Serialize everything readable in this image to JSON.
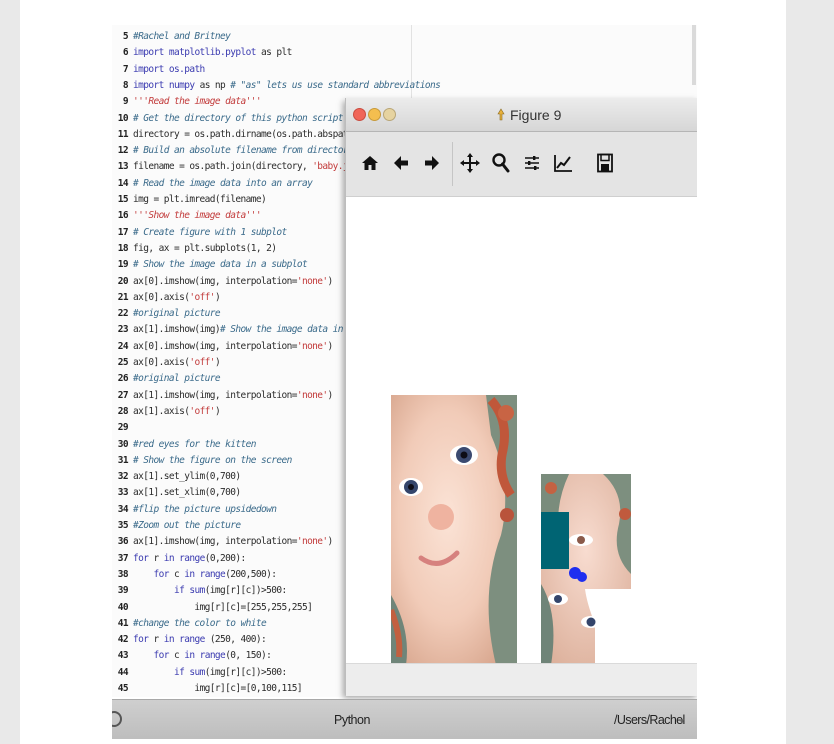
{
  "editor": {
    "lines": [
      {
        "n": "5",
        "parts": [
          {
            "c": "cm",
            "t": "#Rachel and Britney"
          }
        ]
      },
      {
        "n": "6",
        "parts": [
          {
            "c": "kw",
            "t": "import "
          },
          {
            "c": "kw",
            "t": "matplotlib.pyplot"
          },
          {
            "c": "",
            "t": " as plt"
          }
        ]
      },
      {
        "n": "7",
        "parts": [
          {
            "c": "kw",
            "t": "import "
          },
          {
            "c": "kw",
            "t": "os.path"
          }
        ]
      },
      {
        "n": "8",
        "parts": [
          {
            "c": "kw",
            "t": "import "
          },
          {
            "c": "kw",
            "t": "numpy"
          },
          {
            "c": "",
            "t": " as np "
          },
          {
            "c": "cm",
            "t": "# \"as\" lets us use standard abbreviations"
          }
        ]
      },
      {
        "n": "9",
        "parts": [
          {
            "c": "doc",
            "t": "'''Read the image data'''"
          }
        ]
      },
      {
        "n": "10",
        "parts": [
          {
            "c": "cm",
            "t": "# Get the directory of this python script"
          }
        ]
      },
      {
        "n": "11",
        "parts": [
          {
            "c": "",
            "t": "directory = os.path.dirname(os.path.abspath(__file__))"
          }
        ]
      },
      {
        "n": "12",
        "parts": [
          {
            "c": "cm",
            "t": "# Build an absolute filename from directory + filename"
          }
        ]
      },
      {
        "n": "13",
        "parts": [
          {
            "c": "",
            "t": "filename = os.path.join(directory, "
          },
          {
            "c": "str",
            "t": "'baby.jpg'"
          },
          {
            "c": "",
            "t": ")"
          }
        ]
      },
      {
        "n": "14",
        "parts": [
          {
            "c": "cm",
            "t": "# Read the image data into an array"
          }
        ]
      },
      {
        "n": "15",
        "parts": [
          {
            "c": "",
            "t": "img = plt.imread(filename)"
          }
        ]
      },
      {
        "n": "16",
        "parts": [
          {
            "c": "doc",
            "t": "'''Show the image data'''"
          }
        ]
      },
      {
        "n": "17",
        "parts": [
          {
            "c": "cm",
            "t": "# Create figure with 1 subplot"
          }
        ]
      },
      {
        "n": "18",
        "parts": [
          {
            "c": "",
            "t": "fig, ax = plt.subplots(1, 2)"
          }
        ]
      },
      {
        "n": "19",
        "parts": [
          {
            "c": "cm",
            "t": "# Show the image data in a subplot"
          }
        ]
      },
      {
        "n": "20",
        "parts": [
          {
            "c": "",
            "t": "ax[0].imshow(img, interpolation="
          },
          {
            "c": "str",
            "t": "'none'"
          },
          {
            "c": "",
            "t": ")"
          }
        ]
      },
      {
        "n": "21",
        "parts": [
          {
            "c": "",
            "t": "ax[0].axis("
          },
          {
            "c": "str",
            "t": "'off'"
          },
          {
            "c": "",
            "t": ")"
          }
        ]
      },
      {
        "n": "22",
        "parts": [
          {
            "c": "cm",
            "t": "#original picture"
          }
        ]
      },
      {
        "n": "23",
        "parts": [
          {
            "c": "",
            "t": "ax[1].imshow(img)"
          },
          {
            "c": "cm",
            "t": "# Show the image data in a subplot"
          }
        ]
      },
      {
        "n": "24",
        "parts": [
          {
            "c": "",
            "t": "ax[0].imshow(img, interpolation="
          },
          {
            "c": "str",
            "t": "'none'"
          },
          {
            "c": "",
            "t": ")"
          }
        ]
      },
      {
        "n": "25",
        "parts": [
          {
            "c": "",
            "t": "ax[0].axis("
          },
          {
            "c": "str",
            "t": "'off'"
          },
          {
            "c": "",
            "t": ")"
          }
        ]
      },
      {
        "n": "26",
        "parts": [
          {
            "c": "cm",
            "t": "#original picture"
          }
        ]
      },
      {
        "n": "27",
        "parts": [
          {
            "c": "",
            "t": "ax[1].imshow(img, interpolation="
          },
          {
            "c": "str",
            "t": "'none'"
          },
          {
            "c": "",
            "t": ")"
          }
        ]
      },
      {
        "n": "28",
        "parts": [
          {
            "c": "",
            "t": "ax[1].axis("
          },
          {
            "c": "str",
            "t": "'off'"
          },
          {
            "c": "",
            "t": ")"
          }
        ]
      },
      {
        "n": "29",
        "parts": []
      },
      {
        "n": "30",
        "parts": [
          {
            "c": "cm",
            "t": "#red eyes for the kitten"
          }
        ]
      },
      {
        "n": "31",
        "parts": [
          {
            "c": "cm",
            "t": "# Show the figure on the screen"
          }
        ]
      },
      {
        "n": "32",
        "parts": [
          {
            "c": "",
            "t": "ax[1].set_ylim(0,700)"
          }
        ]
      },
      {
        "n": "33",
        "parts": [
          {
            "c": "",
            "t": "ax[1].set_xlim(0,700)"
          }
        ]
      },
      {
        "n": "34",
        "parts": [
          {
            "c": "cm",
            "t": "#flip the picture upsidedown"
          }
        ]
      },
      {
        "n": "35",
        "parts": [
          {
            "c": "cm",
            "t": "#Zoom out the picture"
          }
        ]
      },
      {
        "n": "36",
        "parts": [
          {
            "c": "",
            "t": "ax[1].imshow(img, interpolation="
          },
          {
            "c": "str",
            "t": "'none'"
          },
          {
            "c": "",
            "t": ")"
          }
        ]
      },
      {
        "n": "37",
        "parts": [
          {
            "c": "kw",
            "t": "for "
          },
          {
            "c": "",
            "t": "r "
          },
          {
            "c": "kw",
            "t": "in "
          },
          {
            "c": "kw",
            "t": "range"
          },
          {
            "c": "",
            "t": "(0,200):"
          }
        ]
      },
      {
        "n": "38",
        "parts": [
          {
            "c": "",
            "t": "    "
          },
          {
            "c": "kw",
            "t": "for "
          },
          {
            "c": "",
            "t": "c "
          },
          {
            "c": "kw",
            "t": "in "
          },
          {
            "c": "kw",
            "t": "range"
          },
          {
            "c": "",
            "t": "(200,500):"
          }
        ]
      },
      {
        "n": "39",
        "parts": [
          {
            "c": "",
            "t": "        "
          },
          {
            "c": "kw",
            "t": "if "
          },
          {
            "c": "kw",
            "t": "sum"
          },
          {
            "c": "",
            "t": "(img[r][c])>500:"
          }
        ]
      },
      {
        "n": "40",
        "parts": [
          {
            "c": "",
            "t": "            img[r][c]=[255,255,255]"
          }
        ]
      },
      {
        "n": "41",
        "parts": [
          {
            "c": "cm",
            "t": "#change the color to white"
          }
        ]
      },
      {
        "n": "42",
        "parts": [
          {
            "c": "kw",
            "t": "for "
          },
          {
            "c": "",
            "t": "r "
          },
          {
            "c": "kw",
            "t": "in "
          },
          {
            "c": "kw",
            "t": "range "
          },
          {
            "c": "",
            "t": "(250, 400):"
          }
        ]
      },
      {
        "n": "43",
        "parts": [
          {
            "c": "",
            "t": "    "
          },
          {
            "c": "kw",
            "t": "for "
          },
          {
            "c": "",
            "t": "c "
          },
          {
            "c": "kw",
            "t": "in "
          },
          {
            "c": "kw",
            "t": "range"
          },
          {
            "c": "",
            "t": "(0, 150):"
          }
        ]
      },
      {
        "n": "44",
        "parts": [
          {
            "c": "",
            "t": "        "
          },
          {
            "c": "kw",
            "t": "if "
          },
          {
            "c": "kw",
            "t": "sum"
          },
          {
            "c": "",
            "t": "(img[r][c])>500:"
          }
        ]
      },
      {
        "n": "45",
        "parts": [
          {
            "c": "",
            "t": "            img[r][c]=[0,100,115]"
          }
        ]
      }
    ]
  },
  "figure_window": {
    "title": "Figure 9",
    "toolbar": [
      {
        "name": "home-icon"
      },
      {
        "name": "back-arrow-icon"
      },
      {
        "name": "forward-arrow-icon"
      },
      {
        "name": "pan-move-icon"
      },
      {
        "name": "zoom-magnifier-icon"
      },
      {
        "name": "subplots-config-icon"
      },
      {
        "name": "edit-curves-icon"
      },
      {
        "name": "save-floppy-icon"
      }
    ],
    "panels": [
      {
        "name": "original picture"
      },
      {
        "name": "modified picture"
      }
    ]
  },
  "statusbar": {
    "center": "Python",
    "right": "/Users/Rachel"
  },
  "colors": {
    "keyword": "#3b3bb0",
    "comment": "#3a6a8a",
    "string": "#c23b3b",
    "teal_patch": "#006473"
  }
}
